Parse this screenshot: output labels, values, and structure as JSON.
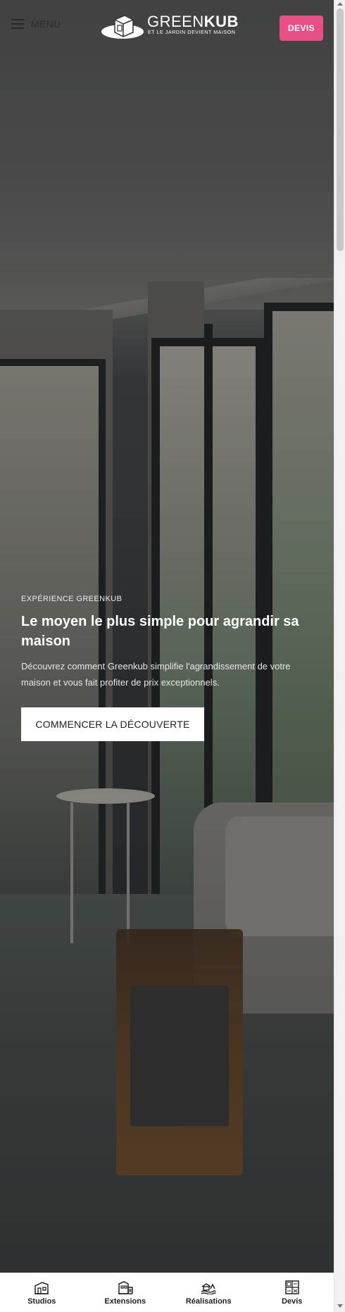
{
  "header": {
    "menu_label": "MENU",
    "logo_main": "GREEN",
    "logo_bold": "KUB",
    "logo_tagline": "ET LE JARDIN DEVIENT MAISON",
    "devis_label": "DEVIS",
    "devis_color": "#e84f86"
  },
  "hero": {
    "eyebrow": "EXPÉRIENCE GREENKUB",
    "title": "Le moyen le plus simple pour agrandir sa maison",
    "description": "Découvrez comment Greenkub simplifie l'agrandissement de votre maison et vous fait profiter de prix exceptionnels.",
    "cta_label": "COMMENCER LA DÉCOUVERTE"
  },
  "bottom_nav": [
    {
      "label": "Studios",
      "icon": "studio-icon"
    },
    {
      "label": "Extensions",
      "icon": "extension-icon"
    },
    {
      "label": "Réalisations",
      "icon": "realisations-icon"
    },
    {
      "label": "Devis",
      "icon": "devis-grid-icon"
    }
  ]
}
